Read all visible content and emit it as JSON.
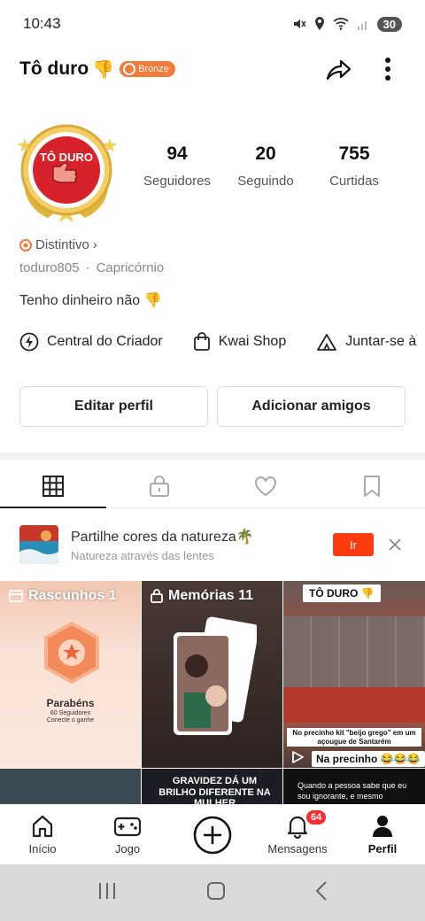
{
  "status_bar": {
    "time": "10:43",
    "battery": "30"
  },
  "header": {
    "name": "Tô duro",
    "name_emoji": "👎",
    "level_badge": "Bronze"
  },
  "avatar": {
    "text": "TÔ DURO"
  },
  "stats": [
    {
      "value": "94",
      "label": "Seguidores"
    },
    {
      "value": "20",
      "label": "Seguindo"
    },
    {
      "value": "755",
      "label": "Curtidas"
    }
  ],
  "profile": {
    "badge_label": "Distintivo",
    "chevron": "›",
    "user_id": "toduro805",
    "separator": "·",
    "sign": "Capricórnio",
    "bio": "Tenho dinheiro não 👎"
  },
  "shortcuts": [
    {
      "label": "Central do Criador",
      "icon": "lightning-icon"
    },
    {
      "label": "Kwai Shop",
      "icon": "shopping-bag-icon"
    },
    {
      "label": "Juntar-se à",
      "icon": "tent-icon"
    }
  ],
  "actions": {
    "edit": "Editar perfil",
    "add_friends": "Adicionar amigos"
  },
  "tabs": [
    "grid-icon",
    "lock-icon",
    "heart-icon",
    "bookmark-icon"
  ],
  "promo": {
    "title": "Partilhe cores da natureza🌴",
    "subtitle": "Natureza através das lentes",
    "button": "Ir",
    "close": "✕"
  },
  "grid": {
    "drafts": {
      "label": "Rascunhos 1",
      "line1": "Parabéns",
      "line2": "60 Seguidores",
      "line3": "Conecte o ganhe"
    },
    "memories": {
      "label": "Memórias 11"
    },
    "video1": {
      "title": "TÔ DURO 👎",
      "caption": "No precinho kit \"beijo grego\" em um açougue de Santarém",
      "small": "Na precinho 😂😂😂"
    },
    "video2": {
      "caption": "GRAVIDEZ DÁ UM BRILHO DIFERENTE NA MULHER"
    },
    "video3": {
      "caption": "Quando a pessoa sabe que eu sou ignorante, e mesmo"
    }
  },
  "bottom_nav": [
    {
      "label": "Início",
      "icon": "home-icon"
    },
    {
      "label": "Jogo",
      "icon": "gamepad-icon"
    },
    {
      "label": "",
      "icon": "plus-circle-icon"
    },
    {
      "label": "Mensagens",
      "icon": "bell-icon",
      "badge": "64"
    },
    {
      "label": "Perfil",
      "icon": "person-icon"
    }
  ],
  "colors": {
    "accent": "#fe3c0e",
    "badge_orange": "#f47a3a",
    "avatar_red": "#d8222b",
    "gold": "#e0b43a"
  }
}
